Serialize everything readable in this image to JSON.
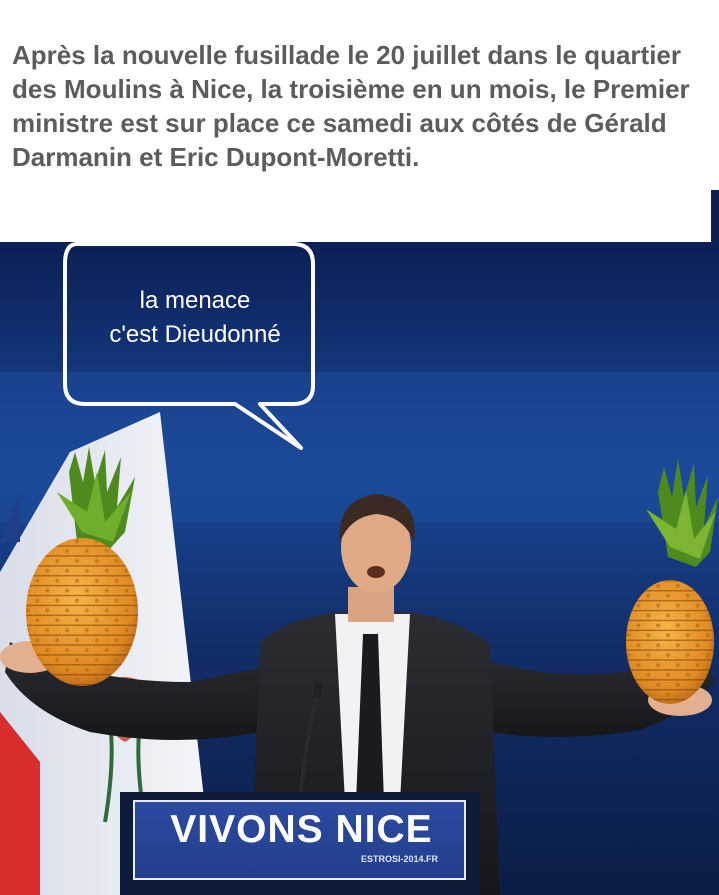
{
  "caption": {
    "text": "Après la nouvelle fusillade le 20 juillet dans le quartier des Moulins à Nice, la troisième en un mois, le Premier ministre est sur place ce samedi aux côtés de Gérald Darmanin et Eric Dupont-Moretti."
  },
  "bubble": {
    "line1": "la menace",
    "line2": "c'est Dieudonné"
  },
  "podium": {
    "main": "VIVONS NICE",
    "sub": "ESTROSI-2014.FR"
  },
  "colors": {
    "background": "#0f2a63",
    "caption_text": "#5c5c5c",
    "podium_blue": "#2c4aa0",
    "pineapple": "#e8962a",
    "leaves": "#4f8a1f"
  },
  "icons": {
    "left_pineapple": "pineapple-icon",
    "right_pineapple": "pineapple-icon"
  }
}
